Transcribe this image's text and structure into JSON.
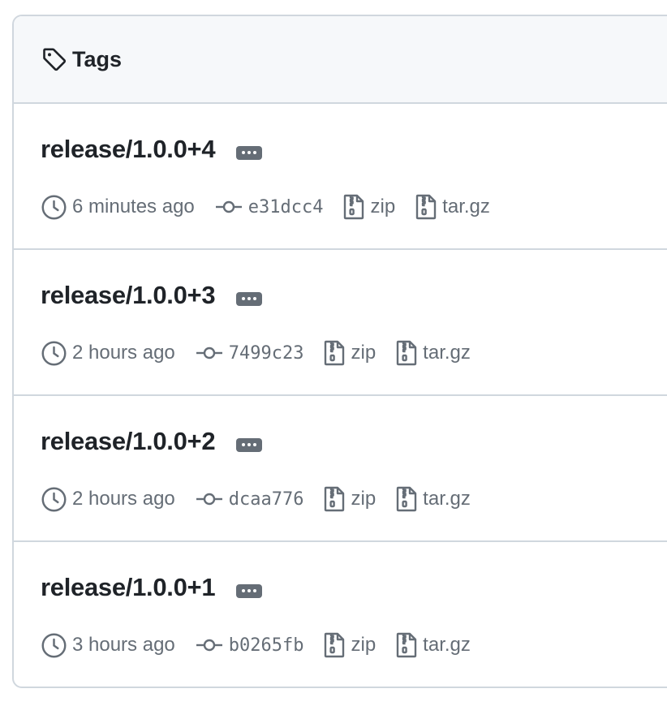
{
  "header": {
    "title": "Tags",
    "icon": "tag-icon"
  },
  "colors": {
    "border": "#d0d7de",
    "header_bg": "#f6f8fa",
    "text": "#1f2328",
    "muted": "#656d76"
  },
  "tags": [
    {
      "name": "release/1.0.0+4",
      "time": "6 minutes ago",
      "sha": "e31dcc4",
      "zip": "zip",
      "targz": "tar.gz"
    },
    {
      "name": "release/1.0.0+3",
      "time": "2 hours ago",
      "sha": "7499c23",
      "zip": "zip",
      "targz": "tar.gz"
    },
    {
      "name": "release/1.0.0+2",
      "time": "2 hours ago",
      "sha": "dcaa776",
      "zip": "zip",
      "targz": "tar.gz"
    },
    {
      "name": "release/1.0.0+1",
      "time": "3 hours ago",
      "sha": "b0265fb",
      "zip": "zip",
      "targz": "tar.gz"
    }
  ]
}
